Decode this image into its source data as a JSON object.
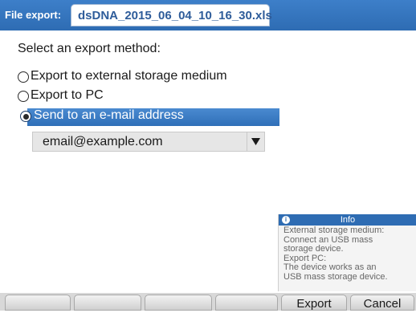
{
  "header": {
    "label": "File export:",
    "filename": "dsDNA_2015_06_04_10_16_30.xls"
  },
  "main": {
    "prompt": "Select an export method:",
    "options": [
      {
        "label": "Export to external storage medium",
        "selected": false
      },
      {
        "label": "Export to PC",
        "selected": false
      },
      {
        "label": "Send to an e-mail address",
        "selected": true
      }
    ],
    "email_select": {
      "value": "email@example.com"
    }
  },
  "info": {
    "icon": "info-icon",
    "title": "Info",
    "lines": [
      "External storage medium:",
      "Connect an USB mass",
      "storage device.",
      "Export PC:",
      "The device works as an",
      "USB mass storage device."
    ]
  },
  "softkeys": [
    {
      "label": ""
    },
    {
      "label": ""
    },
    {
      "label": ""
    },
    {
      "label": ""
    },
    {
      "label": "Export"
    },
    {
      "label": "Cancel"
    }
  ],
  "colors": {
    "header_blue": "#2e6cb3",
    "selection_blue": "#3a7cc4",
    "filename_text": "#2e5c9a"
  }
}
